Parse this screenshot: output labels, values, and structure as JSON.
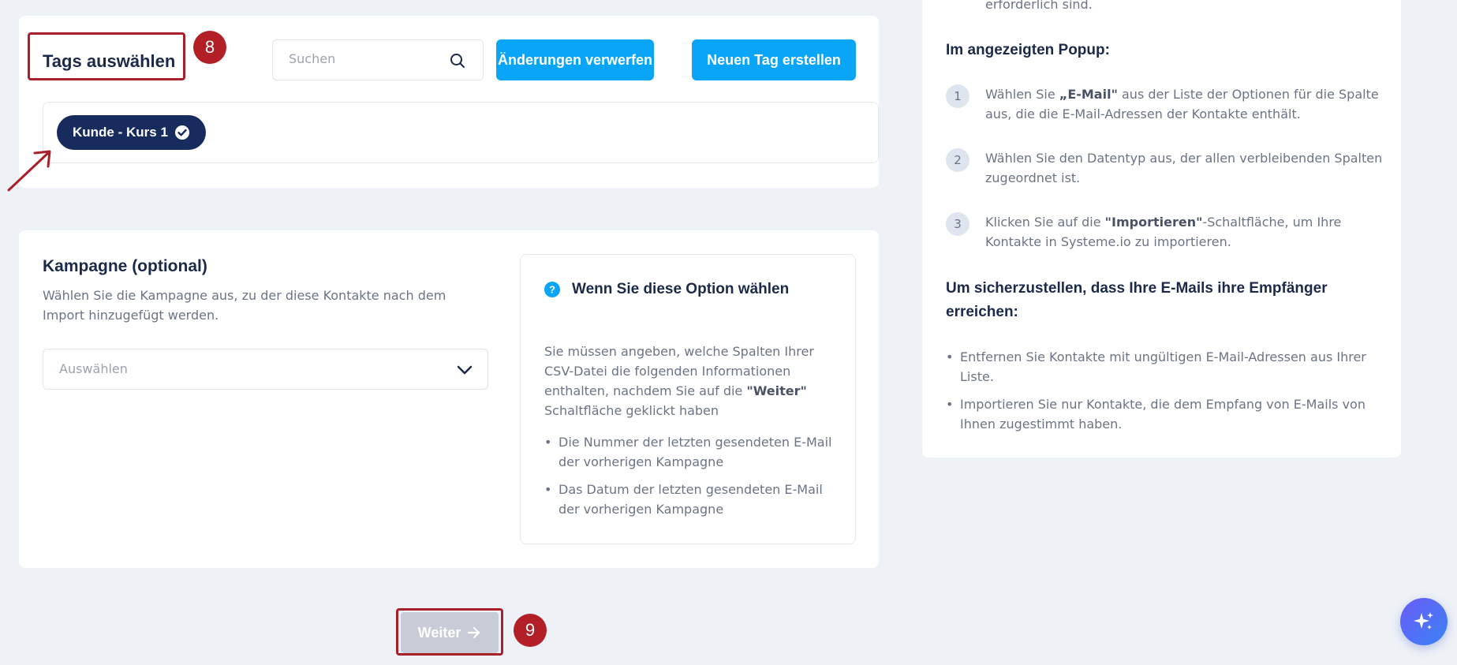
{
  "tags": {
    "title": "Tags auswählen",
    "search_placeholder": "Suchen",
    "discard_label": "Änderungen verwerfen",
    "new_tag_label": "Neuen Tag erstellen",
    "selected_tag": "Kunde - Kurs 1"
  },
  "campaign": {
    "title": "Kampagne (optional)",
    "description": "Wählen Sie die Kampagne aus, zu der diese Kontakte nach dem Import hinzugefügt werden.",
    "select_placeholder": "Auswählen",
    "info": {
      "title": "Wenn Sie diese Option wählen",
      "text_prefix": "Sie müssen angeben, welche Spalten Ihrer CSV-Datei die folgenden Informationen enthalten, nachdem Sie auf die ",
      "text_bold": "\"Weiter\"",
      "text_suffix": " Schaltfläche geklickt haben",
      "items": [
        "Die Nummer der letzten gesendeten E-Mail der vorherigen Kampagne",
        "Das Datum der letzten gesendeten E-Mail der vorherigen Kampagne"
      ]
    }
  },
  "next_button_label": "Weiter",
  "annotations": {
    "badge_8": "8",
    "badge_9": "9"
  },
  "right_panel": {
    "top_text": "erforderlich sind.",
    "popup_heading": "Im angezeigten Popup:",
    "steps": [
      {
        "num": "1",
        "pre": "Wählen Sie ",
        "bold": "„E-Mail\"",
        "post": " aus der Liste der Optionen für die Spalte aus, die die E-Mail-Adressen der Kontakte enthält."
      },
      {
        "num": "2",
        "pre": "Wählen Sie den Datentyp aus, der allen verbleibenden Spalten zugeordnet ist.",
        "bold": "",
        "post": ""
      },
      {
        "num": "3",
        "pre": "Klicken Sie auf die ",
        "bold": "\"Importieren\"",
        "post": "-Schaltfläche, um Ihre Kontakte in Systeme.io zu importieren."
      }
    ],
    "delivery_heading": "Um sicherzustellen, dass Ihre E-Mails ihre Empfänger erreichen:",
    "delivery_items": [
      "Entfernen Sie Kontakte mit ungültigen E-Mail-Adressen aus Ihrer Liste.",
      "Importieren Sie nur Kontakte, die dem Empfang von E-Mails von Ihnen zugestimmt haben."
    ]
  },
  "colors": {
    "primary": "#0aa5f7",
    "tag_chip": "#172b5c",
    "annotation": "#b31f26",
    "disabled": "#c7ccd6"
  },
  "icons": [
    "search-icon",
    "check-circle-icon",
    "chevron-down-icon",
    "question-icon",
    "arrow-right-icon",
    "sparkle-icon"
  ]
}
